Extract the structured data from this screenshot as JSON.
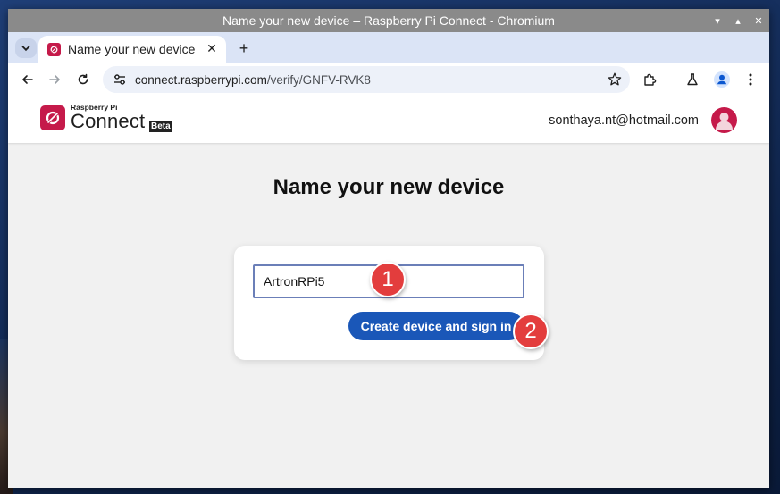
{
  "window": {
    "title": "Name your new device – Raspberry Pi Connect - Chromium",
    "controls": {
      "minimize": "▾",
      "maximize": "▴",
      "close": "✕"
    }
  },
  "tabs": {
    "search_icon": "chevron-down-icon",
    "active": {
      "title": "Name your new device",
      "close": "✕"
    },
    "new_tab": "+"
  },
  "toolbar": {
    "back": "←",
    "forward": "→",
    "url_host": "connect.raspberrypi.com",
    "url_path": "/verify/GNFV-RVK8"
  },
  "site": {
    "logo_small": "Raspberry Pi",
    "logo_big": "Connect",
    "logo_badge": "Beta",
    "user_email": "sonthaya.nt@hotmail.com"
  },
  "form": {
    "heading": "Name your new device",
    "device_name_value": "ArtronRPi5",
    "submit_label": "Create device and sign in"
  },
  "annotations": {
    "step1": "1",
    "step2": "2",
    "color": "#e33d3d"
  },
  "colors": {
    "brand": "#c51a4a",
    "primary_button": "#1a57b8",
    "tabstrip": "#dbe4f6",
    "titlebar": "#8a8a8a"
  }
}
